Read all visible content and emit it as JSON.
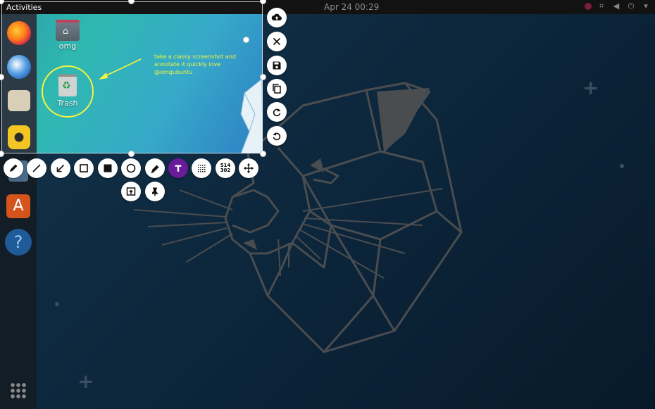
{
  "topbar": {
    "activities": "Activities",
    "clock": "Apr 24  00:29",
    "tray_icons": [
      "status-icon",
      "network-icon",
      "volume-icon",
      "power-icon",
      "menu-arrow-icon"
    ]
  },
  "dock": {
    "items": [
      "firefox",
      "thunderbird",
      "files",
      "rhythmbox",
      "libreoffice-writer",
      "software",
      "help"
    ],
    "show_apps": "show-applications"
  },
  "capture": {
    "desktop_icons": [
      {
        "label": "omg"
      },
      {
        "label": "Trash"
      }
    ],
    "annotation_text": "take a classy screenshot and annotate it quickly love @omgubuntu",
    "annotation_color": "#f4f442",
    "highlight_color": "#f4f442"
  },
  "toolbar_right": [
    {
      "name": "upload",
      "icon": "cloud-upload-icon"
    },
    {
      "name": "close",
      "icon": "close-icon"
    },
    {
      "name": "save",
      "icon": "save-icon"
    },
    {
      "name": "copy",
      "icon": "copy-icon"
    },
    {
      "name": "redo",
      "icon": "redo-icon"
    },
    {
      "name": "undo",
      "icon": "undo-icon"
    }
  ],
  "toolbar_bottom": [
    {
      "name": "pencil",
      "icon": "pencil-icon"
    },
    {
      "name": "line",
      "icon": "line-icon"
    },
    {
      "name": "arrow",
      "icon": "arrow-icon"
    },
    {
      "name": "rectangle",
      "icon": "rectangle-icon"
    },
    {
      "name": "filled-rectangle",
      "icon": "filled-rectangle-icon"
    },
    {
      "name": "circle",
      "icon": "circle-icon"
    },
    {
      "name": "marker",
      "icon": "marker-icon"
    },
    {
      "name": "text",
      "icon": "text-icon",
      "active": true,
      "accent": "#6a1b9a"
    },
    {
      "name": "pixelate",
      "icon": "pixelate-icon"
    },
    {
      "name": "selection-size",
      "icon": "size-icon"
    },
    {
      "name": "move",
      "icon": "move-icon"
    },
    {
      "name": "app-launcher",
      "icon": "launcher-icon"
    },
    {
      "name": "pin",
      "icon": "pin-icon"
    }
  ],
  "selection_size": {
    "width": "514",
    "height": "302"
  }
}
